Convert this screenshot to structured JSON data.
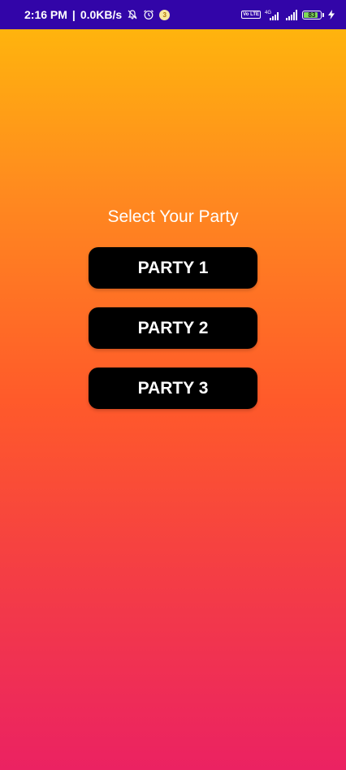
{
  "status_bar": {
    "time": "2:16 PM",
    "separator": "|",
    "net_speed": "0.0KB/s",
    "notification_badge": "3",
    "network_type": "4G",
    "volte_label": "Vo LTE",
    "battery_level": "83",
    "battery_fraction": 0.83,
    "icons": [
      "mute-notifications-icon",
      "alarm-icon",
      "notification-badge-icon",
      "volte-icon",
      "signal-4g-icon",
      "signal-icon",
      "battery-icon",
      "charging-icon"
    ],
    "colors": {
      "background": "#3205a8",
      "battery_fill": "#7ed957"
    }
  },
  "main": {
    "title": "Select Your Party",
    "buttons": [
      {
        "label": "PARTY 1"
      },
      {
        "label": "PARTY 2"
      },
      {
        "label": "PARTY 3"
      }
    ],
    "colors": {
      "gradient_top": "#ffbb0a",
      "gradient_middle": "#ff5a2a",
      "gradient_bottom": "#eb2262",
      "button_background": "#000000",
      "button_text": "#ffffff"
    }
  }
}
